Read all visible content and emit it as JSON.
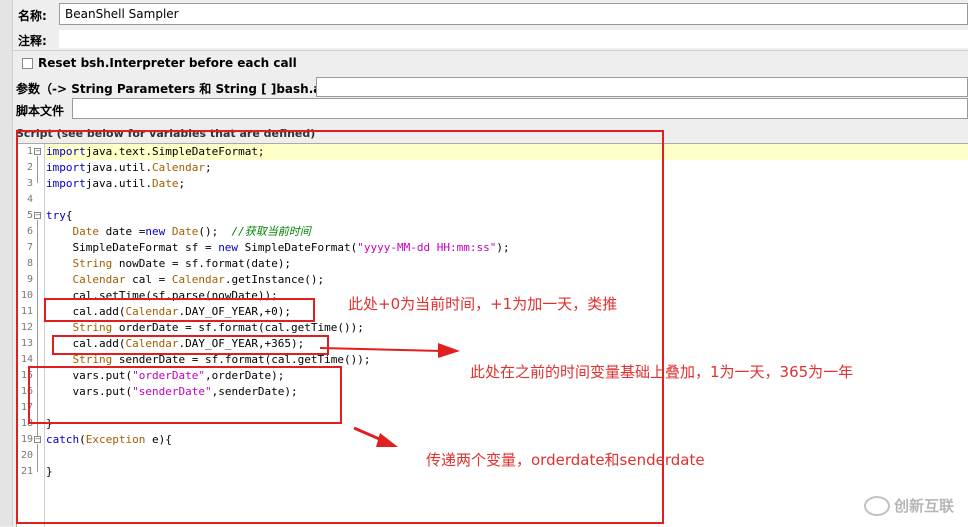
{
  "form": {
    "name_label": "名称:",
    "name_value": "BeanShell Sampler",
    "comment_label": "注释:",
    "reset_checkbox_label": "Reset bsh.Interpreter before each call",
    "params_label": "参数（-> String Parameters 和 String [ ]bash.args）",
    "script_file_label": "脚本文件",
    "script_section_label": "Script (see below for variables that are defined)"
  },
  "editor": {
    "line_numbers": [
      "1",
      "2",
      "3",
      "4",
      "5",
      "6",
      "7",
      "8",
      "9",
      "10",
      "11",
      "12",
      "13",
      "14",
      "15",
      "16",
      "17",
      "18",
      "19",
      "20",
      "21"
    ]
  },
  "annotations": {
    "note1": "此处+0为当前时间，+1为加一天，类推",
    "note2": "此处在之前的时间变量基础上叠加，1为一天，365为一年",
    "note3": "传递两个变量，orderdate和senderdate"
  },
  "colors": {
    "annotation_red": "#e02020",
    "keyword_blue": "#0000c0",
    "type_brown": "#a06000",
    "string_magenta": "#c000c0",
    "comment_green": "#008000",
    "current_line": "#ffffc8"
  },
  "watermark": "创新互联"
}
